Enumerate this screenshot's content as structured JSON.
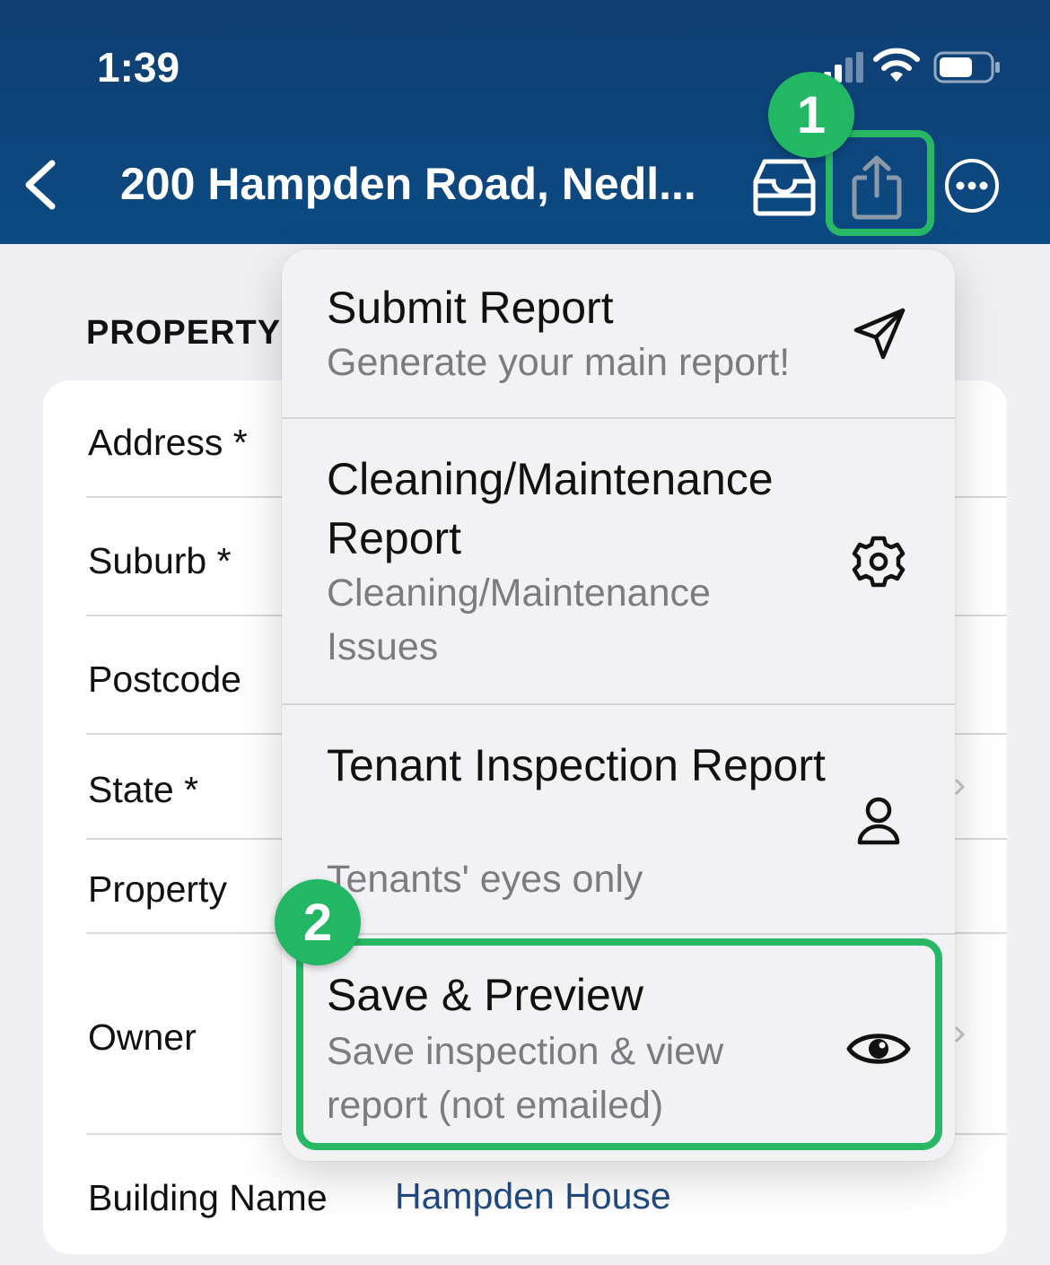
{
  "status_bar": {
    "time": "1:39"
  },
  "nav": {
    "title": "200 Hampden Road, Nedl..."
  },
  "section": {
    "label": "PROPERTY D"
  },
  "form": {
    "rows": [
      {
        "label": "Address *"
      },
      {
        "label": "Suburb *"
      },
      {
        "label": "Postcode"
      },
      {
        "label": "State *"
      },
      {
        "label": "Property"
      },
      {
        "label": "Owner"
      },
      {
        "label": "Building Name",
        "value": "Hampden House"
      }
    ]
  },
  "menu": {
    "items": [
      {
        "title": "Submit Report",
        "subtitle": "Generate your main report!",
        "icon": "send-icon"
      },
      {
        "title": "Cleaning/Maintenance Report",
        "subtitle": "Cleaning/Maintenance Issues",
        "icon": "gear-icon"
      },
      {
        "title": "Tenant Inspection Report",
        "subtitle": "Tenants' eyes only",
        "icon": "person-icon"
      },
      {
        "title": "Save & Preview",
        "subtitle": "Save inspection & view report (not emailed)",
        "icon": "eye-icon"
      }
    ]
  },
  "callouts": {
    "one": "1",
    "two": "2"
  },
  "colors": {
    "header": "#0f3f72",
    "highlight": "#28b865",
    "link": "#224a80"
  }
}
